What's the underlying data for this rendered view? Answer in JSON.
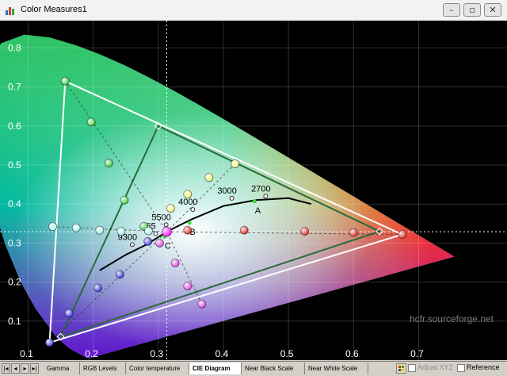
{
  "window": {
    "title": "Color Measures1",
    "controls": [
      "–",
      "▫",
      "✕"
    ]
  },
  "axes": {
    "x_ticks": [
      "0.1",
      "0.2",
      "0.3",
      "0.4",
      "0.5",
      "0.6",
      "0.7"
    ],
    "y_ticks": [
      "0.8",
      "0.7",
      "0.6",
      "0.5",
      "0.4",
      "0.3",
      "0.2",
      "0.1"
    ],
    "xlim": [
      0.08,
      0.77
    ],
    "ylim": [
      0.0,
      0.87
    ]
  },
  "chart_data": {
    "type": "scatter",
    "title": "",
    "xlabel": "",
    "ylabel": "",
    "grid": true,
    "gamut_reference": [
      [
        0.64,
        0.33
      ],
      [
        0.3,
        0.6
      ],
      [
        0.15,
        0.06
      ]
    ],
    "gamut_measured": [
      [
        0.675,
        0.322
      ],
      [
        0.157,
        0.715
      ],
      [
        0.133,
        0.045
      ]
    ],
    "white_point": [
      0.313,
      0.329
    ],
    "red_sat": [
      [
        0.675,
        0.322
      ],
      [
        0.6,
        0.327
      ],
      [
        0.525,
        0.33
      ],
      [
        0.432,
        0.333
      ],
      [
        0.345,
        0.333
      ]
    ],
    "green_sat": [
      [
        0.157,
        0.715
      ],
      [
        0.197,
        0.61
      ],
      [
        0.224,
        0.505
      ],
      [
        0.248,
        0.41
      ],
      [
        0.278,
        0.343
      ]
    ],
    "blue_sat": [
      [
        0.133,
        0.045
      ],
      [
        0.163,
        0.12
      ],
      [
        0.207,
        0.185
      ],
      [
        0.241,
        0.22
      ],
      [
        0.284,
        0.304
      ]
    ],
    "cyan_sat": [
      [
        0.138,
        0.342
      ],
      [
        0.174,
        0.339
      ],
      [
        0.21,
        0.333
      ],
      [
        0.243,
        0.33
      ],
      [
        0.285,
        0.331
      ]
    ],
    "magenta_sat": [
      [
        0.367,
        0.144
      ],
      [
        0.345,
        0.19
      ],
      [
        0.326,
        0.249
      ],
      [
        0.302,
        0.3
      ]
    ],
    "yellow_sat": [
      [
        0.418,
        0.503
      ],
      [
        0.378,
        0.468
      ],
      [
        0.345,
        0.425
      ],
      [
        0.319,
        0.389
      ]
    ],
    "planckian_locus": [
      [
        0.21,
        0.23
      ],
      [
        0.25,
        0.27
      ],
      [
        0.283,
        0.297
      ],
      [
        0.313,
        0.329
      ],
      [
        0.35,
        0.36
      ],
      [
        0.4,
        0.395
      ],
      [
        0.45,
        0.41
      ],
      [
        0.5,
        0.415
      ],
      [
        0.535,
        0.4
      ]
    ],
    "temperature_labels": [
      {
        "label": "2700",
        "x": 0.465,
        "y": 0.42
      },
      {
        "label": "3000",
        "x": 0.413,
        "y": 0.415
      },
      {
        "label": "4000",
        "x": 0.353,
        "y": 0.386
      },
      {
        "label": "5500",
        "x": 0.312,
        "y": 0.347
      },
      {
        "label": "65",
        "x": 0.296,
        "y": 0.324
      },
      {
        "label": "9300",
        "x": 0.26,
        "y": 0.296
      }
    ],
    "illuminants": [
      {
        "label": "A",
        "x": 0.448,
        "y": 0.407
      },
      {
        "label": "B",
        "x": 0.348,
        "y": 0.352
      },
      {
        "label": "C",
        "x": 0.31,
        "y": 0.316
      }
    ],
    "measured_white": [
      0.313,
      0.329
    ],
    "crosshair": [
      0.313,
      0.329
    ]
  },
  "colors": {
    "red": "#e0281e",
    "green": "#3cc83c",
    "blue": "#3030d8",
    "cyan": "#a8f0e8",
    "magenta": "#e040e0",
    "yellow": "#f0f070",
    "white_point": "#ff00ff"
  },
  "watermark": "hcfr.sourceforge.net",
  "tabs": [
    {
      "label": "Gamma",
      "active": false
    },
    {
      "label": "RGB Levels",
      "active": false
    },
    {
      "label": "Color temperature",
      "active": false
    },
    {
      "label": "CIE Diagram",
      "active": true
    },
    {
      "label": "Near Black Scale",
      "active": false
    },
    {
      "label": "Near White Scale",
      "active": false
    }
  ],
  "nav": [
    "|◂",
    "◂",
    "▸",
    "▸|"
  ],
  "options": {
    "adjust_xyz": {
      "label": "Adjust XYZ",
      "checked": false,
      "enabled": false
    },
    "reference": {
      "label": "Reference",
      "checked": false,
      "enabled": true
    }
  }
}
